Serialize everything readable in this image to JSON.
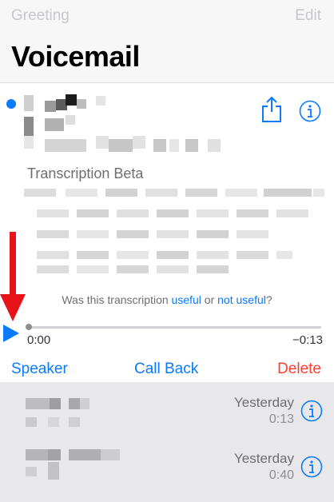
{
  "nav": {
    "left": "Greeting",
    "right": "Edit"
  },
  "title": "Voicemail",
  "expanded": {
    "unread": true,
    "transcription_title": "Transcription Beta",
    "feedback": {
      "prefix": "Was this transcription ",
      "useful": "useful",
      "middle": " or ",
      "not_useful": "not useful",
      "suffix": "?"
    },
    "progress": 0,
    "time_start": "0:00",
    "time_end": "−0:13",
    "actions": {
      "speaker": "Speaker",
      "call_back": "Call Back",
      "delete": "Delete"
    }
  },
  "list": [
    {
      "date": "Yesterday",
      "duration": "0:13"
    },
    {
      "date": "Yesterday",
      "duration": "0:40"
    }
  ],
  "colors": {
    "accent": "#0a7aff",
    "destructive": "#ff3b30",
    "annotation_arrow": "#e8121b"
  },
  "icons": {
    "share": "share-icon",
    "info": "info-icon",
    "play": "play-icon",
    "arrow": "down-arrow-annotation"
  }
}
